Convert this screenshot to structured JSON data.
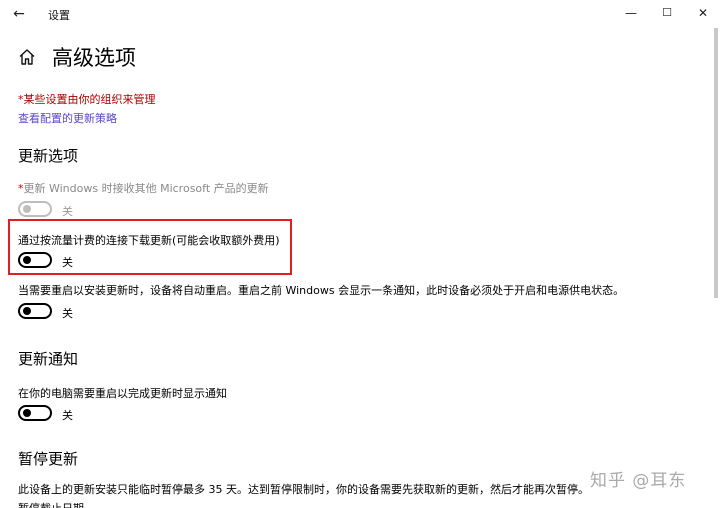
{
  "window": {
    "title": "设置",
    "back_icon": "←",
    "minimize_icon": "—",
    "maximize_icon": "☐",
    "close_icon": "✕"
  },
  "header": {
    "title": "高级选项",
    "home_icon": "home-icon"
  },
  "notices": {
    "org_managed": "*某些设置由你的组织来管理",
    "view_policies_link": "查看配置的更新策略"
  },
  "update_options": {
    "heading": "更新选项",
    "other_products": {
      "required_mark": "*",
      "label": "更新 Windows 时接收其他 Microsoft 产品的更新",
      "state": "关",
      "enabled": false
    },
    "metered_download": {
      "label": "通过按流量计费的连接下载更新(可能会收取额外费用)",
      "state": "关"
    },
    "auto_restart": {
      "label": "当需要重启以安装更新时，设备将自动重启。重启之前 Windows 会显示一条通知，此时设备必须处于开启和电源供电状态。",
      "state": "关"
    }
  },
  "update_notifications": {
    "heading": "更新通知",
    "restart_notification": {
      "label": "在你的电脑需要重启以完成更新时显示通知",
      "state": "关"
    }
  },
  "pause_updates": {
    "heading": "暂停更新",
    "description": "此设备上的更新安装只能临时暂停最多 35 天。达到暂停限制时，你的设备需要先获取新的更新，然后才能再次暂停。",
    "cut_off_label": "暂停截止日期"
  },
  "watermark": "知乎 @耳东",
  "colors": {
    "org_notice": "#a80000",
    "link": "#5b47c9",
    "highlight_border": "#e02020"
  }
}
